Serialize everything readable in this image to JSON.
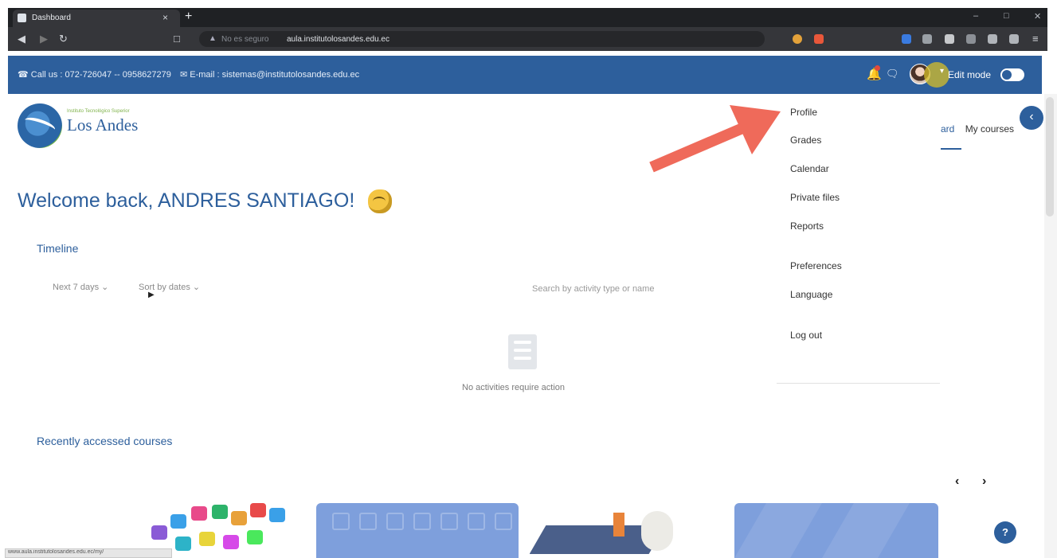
{
  "browser": {
    "tab_title": "Dashboard",
    "tab_close": "×",
    "new_tab": "+",
    "insecure_label": "No es seguro",
    "url": "aula.institutolosandes.edu.ec"
  },
  "topbar": {
    "phone": "072-726047 -- 0958627279",
    "phone_label": "☎ Call us : 072-726047 -- 0958627279",
    "email_label": "✉ E-mail : sistemas@institutolosandes.edu.ec",
    "edit_mode_label": "Edit mode"
  },
  "logo": {
    "tagline": "Instituto Tecnológico Superior",
    "name": "Los Andes"
  },
  "nav": {
    "dashboard_partial": "ard",
    "my_courses": "My courses"
  },
  "welcome": "Welcome back, ANDRES SANTIAGO!",
  "timeline": {
    "title": "Timeline",
    "filter_days": "Next 7 days ⌄",
    "sort": "Sort by dates ⌄",
    "search_placeholder": "Search by activity type or name",
    "empty_message": "No activities require action"
  },
  "recent": {
    "title": "Recently accessed courses"
  },
  "user_menu": {
    "items": [
      "Profile",
      "Grades",
      "Calendar",
      "Private files",
      "Reports",
      "Preferences",
      "Language",
      "Log out"
    ]
  },
  "help_label": "?",
  "status_url": "www.aula.institutolosandes.edu.ec/my/",
  "colors": {
    "brand": "#2d5f9c",
    "annotation_arrow": "#ef6a5a"
  }
}
